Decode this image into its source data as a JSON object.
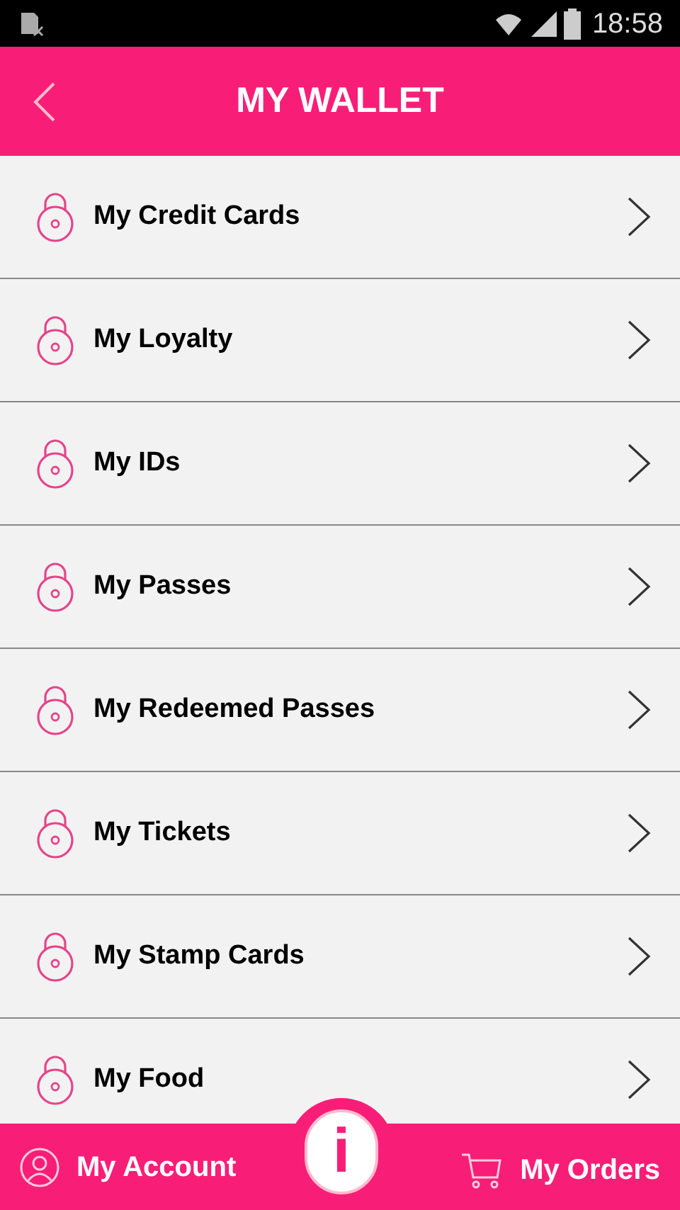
{
  "status_bar": {
    "time": "18:58"
  },
  "header": {
    "title": "MY WALLET"
  },
  "items": [
    {
      "label": "My Credit Cards"
    },
    {
      "label": "My Loyalty"
    },
    {
      "label": "My IDs"
    },
    {
      "label": "My Passes"
    },
    {
      "label": "My Redeemed Passes"
    },
    {
      "label": "My Tickets"
    },
    {
      "label": "My Stamp Cards"
    },
    {
      "label": "My Food"
    }
  ],
  "bottom_bar": {
    "account": "My Account",
    "info": "i",
    "orders": "My Orders"
  }
}
